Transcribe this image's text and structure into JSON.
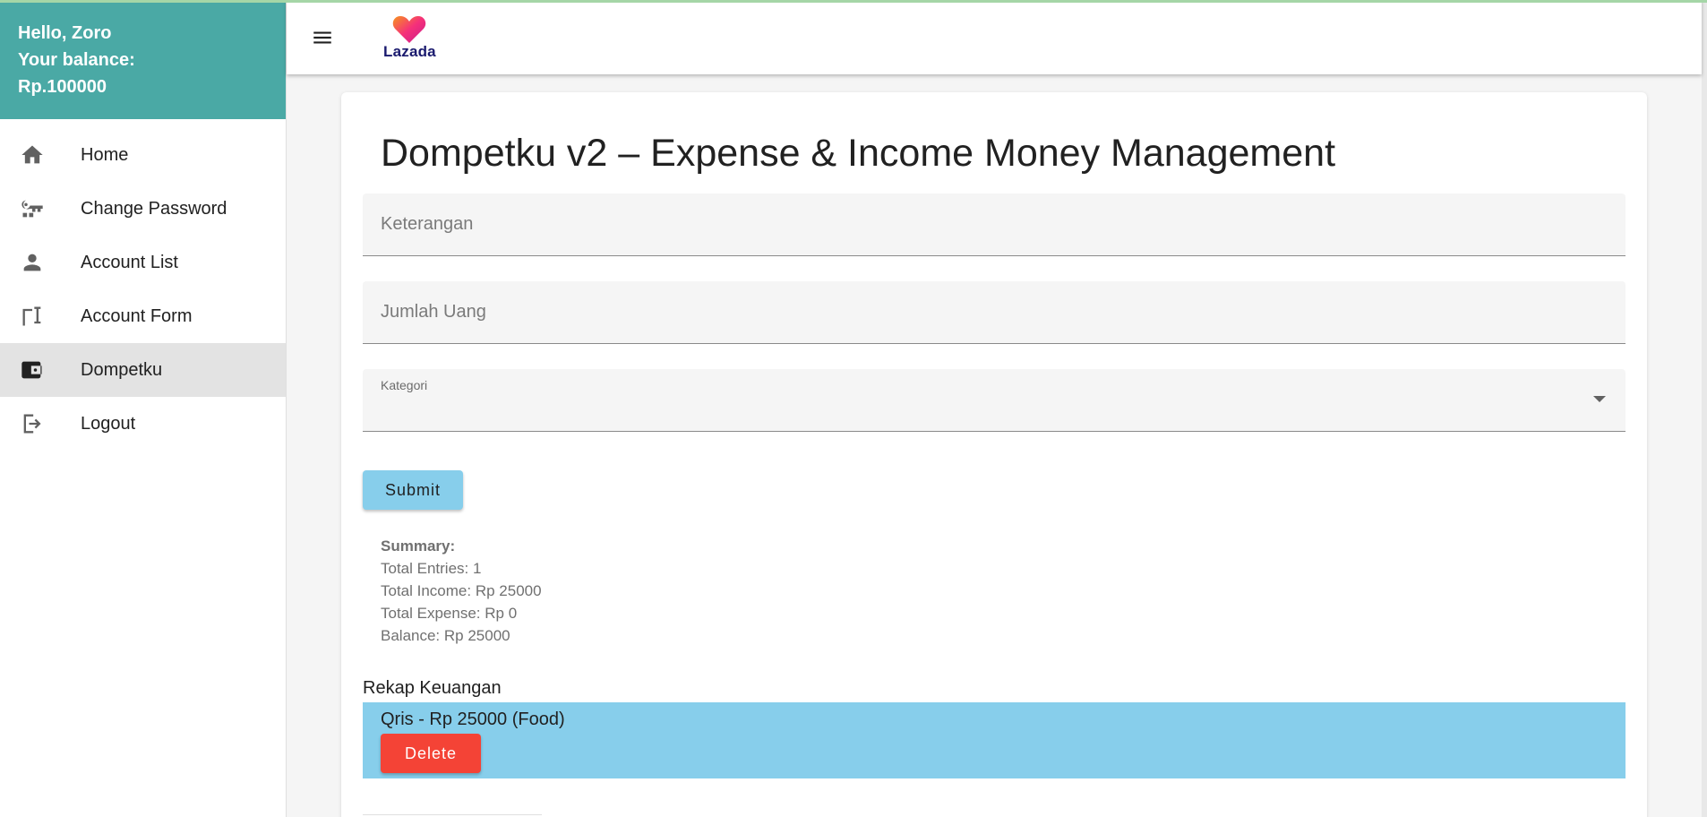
{
  "sidebar": {
    "greeting": "Hello, Zoro",
    "balance_label": "Your balance:",
    "balance_value": "Rp.100000",
    "items": [
      {
        "label": "Home",
        "icon": "home-icon"
      },
      {
        "label": "Change Password",
        "icon": "key-icon"
      },
      {
        "label": "Account List",
        "icon": "person-icon"
      },
      {
        "label": "Account Form",
        "icon": "form-icon"
      },
      {
        "label": "Dompetku",
        "icon": "wallet-icon",
        "active": true
      },
      {
        "label": "Logout",
        "icon": "logout-icon"
      }
    ]
  },
  "appbar": {
    "menu_icon": "menu-icon",
    "logo_text": "Lazada"
  },
  "main": {
    "title": "Dompetku v2 – Expense & Income Money Management",
    "keterangan_placeholder": "Keterangan",
    "jumlah_placeholder": "Jumlah Uang",
    "kategori_label": "Kategori",
    "kategori_value": "",
    "submit_label": "Submit",
    "summary": {
      "title": "Summary:",
      "total_entries": "Total Entries: 1",
      "total_income": "Total Income: Rp 25000",
      "total_expense": "Total Expense: Rp 0",
      "balance": "Balance: Rp 25000"
    },
    "rekap": {
      "title": "Rekap Keuangan",
      "entries": [
        {
          "text": "Qris - Rp 25000 (Food)",
          "delete_label": "Delete"
        }
      ]
    }
  },
  "colors": {
    "sidebar_header": "#4aa9a5",
    "submit_button": "#87ceeb",
    "entry_background": "#87ceeb",
    "delete_button": "#f44336"
  }
}
